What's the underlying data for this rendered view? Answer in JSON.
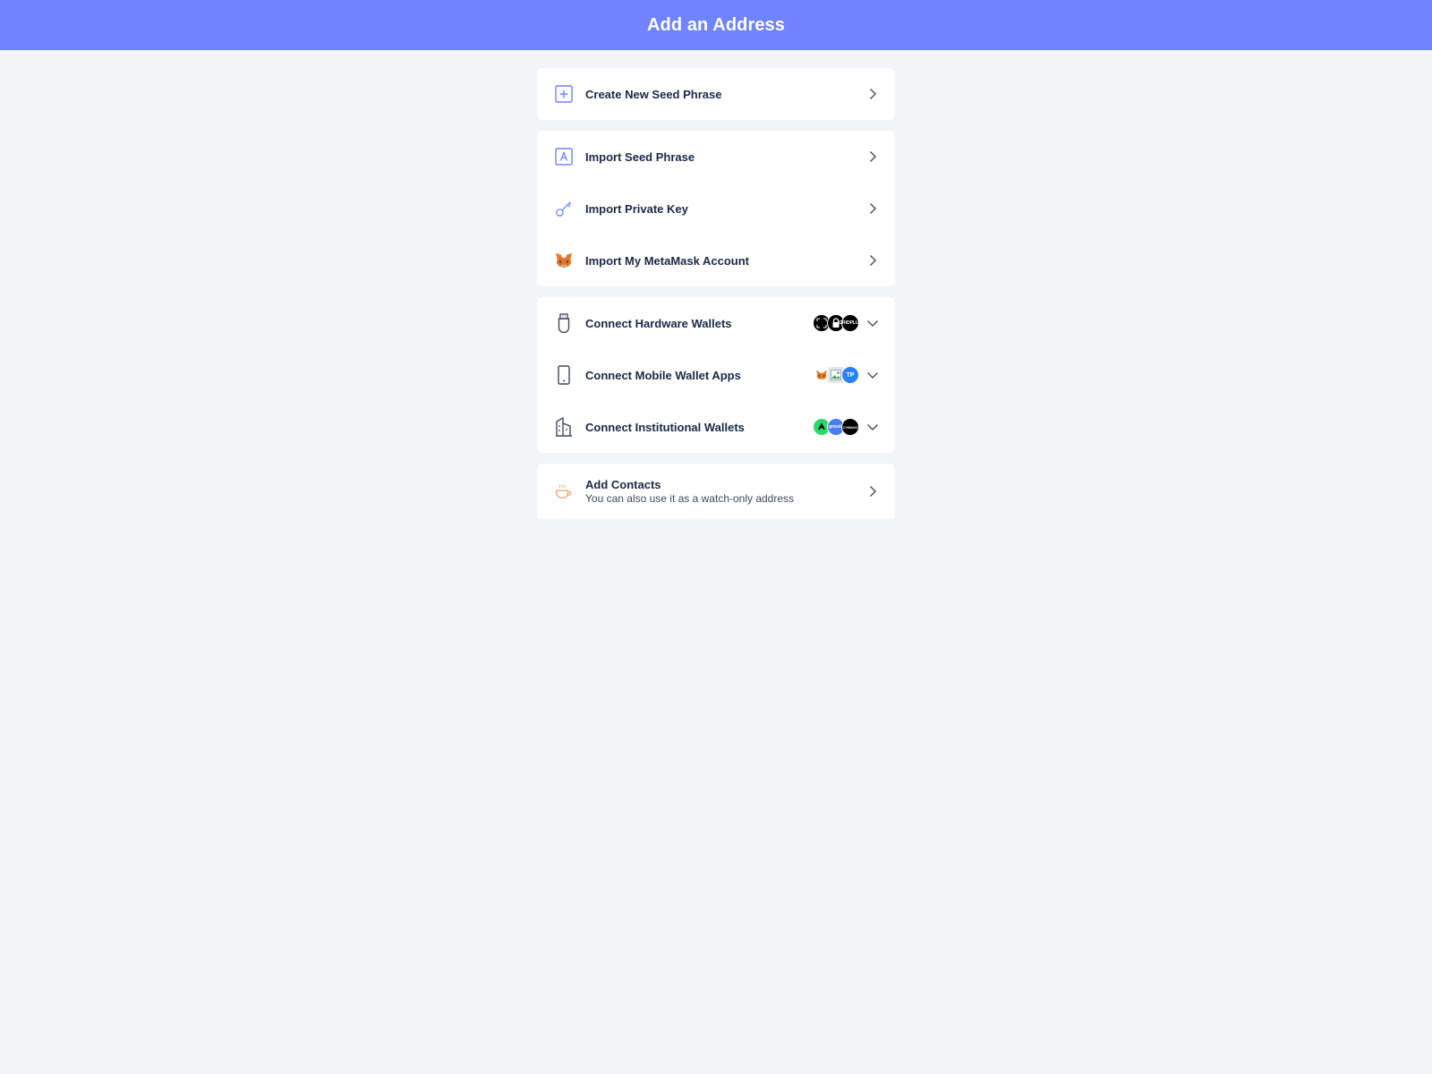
{
  "header": {
    "title": "Add an Address"
  },
  "groups": [
    {
      "items": [
        {
          "id": "create-seed",
          "label": "Create New Seed Phrase",
          "icon": "plus-square-icon",
          "action": "arrow"
        }
      ]
    },
    {
      "items": [
        {
          "id": "import-seed",
          "label": "Import Seed Phrase",
          "icon": "letter-a-square-icon",
          "action": "arrow"
        },
        {
          "id": "import-key",
          "label": "Import Private Key",
          "icon": "key-icon",
          "action": "arrow"
        },
        {
          "id": "import-metamask",
          "label": "Import My MetaMask Account",
          "icon": "metamask-fox-icon",
          "action": "arrow"
        }
      ]
    },
    {
      "items": [
        {
          "id": "hardware",
          "label": "Connect Hardware Wallets",
          "icon": "usb-device-icon",
          "action": "expand"
        },
        {
          "id": "mobile",
          "label": "Connect Mobile Wallet Apps",
          "icon": "mobile-phone-icon",
          "action": "expand"
        },
        {
          "id": "institutional",
          "label": "Connect Institutional Wallets",
          "icon": "building-icon",
          "action": "expand"
        }
      ]
    },
    {
      "items": [
        {
          "id": "contacts",
          "label": "Add Contacts",
          "sub": "You can also use it as a watch-only address",
          "icon": "coffee-cup-icon",
          "action": "arrow"
        }
      ]
    }
  ],
  "logo_text": {
    "hardware_3": "GRIDPLUS",
    "mobile_3": "TP",
    "inst_2": "gnosis",
    "inst_3": "CYBAVO"
  },
  "colors": {
    "header_bg": "#7084ff",
    "accent": "#7084ff",
    "page_bg": "#f2f4f8",
    "text": "#192945",
    "contacts_icon": "#f3a26e"
  }
}
